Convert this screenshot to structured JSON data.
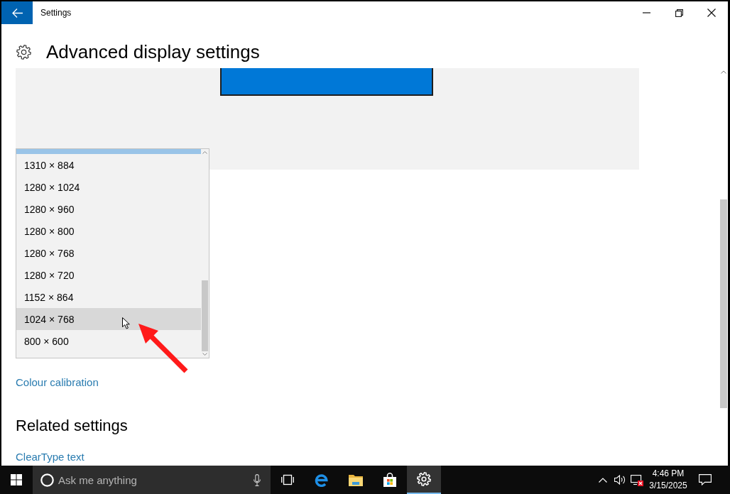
{
  "window": {
    "title": "Settings"
  },
  "header": {
    "title": "Advanced display settings"
  },
  "resolution_dropdown": {
    "items": [
      {
        "kind": "partial",
        "selected": true,
        "hovered": false
      },
      {
        "kind": "option",
        "label": "1310 × 884",
        "selected": false,
        "hovered": false
      },
      {
        "kind": "option",
        "label": "1280 × 1024",
        "selected": false,
        "hovered": false
      },
      {
        "kind": "option",
        "label": "1280 × 960",
        "selected": false,
        "hovered": false
      },
      {
        "kind": "option",
        "label": "1280 × 800",
        "selected": false,
        "hovered": false
      },
      {
        "kind": "option",
        "label": "1280 × 768",
        "selected": false,
        "hovered": false
      },
      {
        "kind": "option",
        "label": "1280 × 720",
        "selected": false,
        "hovered": false
      },
      {
        "kind": "option",
        "label": "1152 × 864",
        "selected": false,
        "hovered": false
      },
      {
        "kind": "option",
        "label": "1024 × 768",
        "selected": false,
        "hovered": true
      },
      {
        "kind": "option",
        "label": "800 × 600",
        "selected": false,
        "hovered": false
      }
    ]
  },
  "links": [
    {
      "label": "Colour calibration"
    }
  ],
  "related_settings": {
    "heading": "Related settings",
    "links": [
      {
        "label": "ClearType text"
      }
    ]
  },
  "taskbar": {
    "search": {
      "placeholder": "Ask me anything"
    },
    "apps": [
      {
        "kind": "taskview",
        "selected": false
      },
      {
        "kind": "browser",
        "selected": false
      },
      {
        "kind": "folder",
        "selected": false
      },
      {
        "kind": "store",
        "selected": false
      },
      {
        "kind": "settings",
        "selected": true
      }
    ],
    "clock": {
      "time": "4:46 PM",
      "date": "3/15/2025"
    }
  }
}
